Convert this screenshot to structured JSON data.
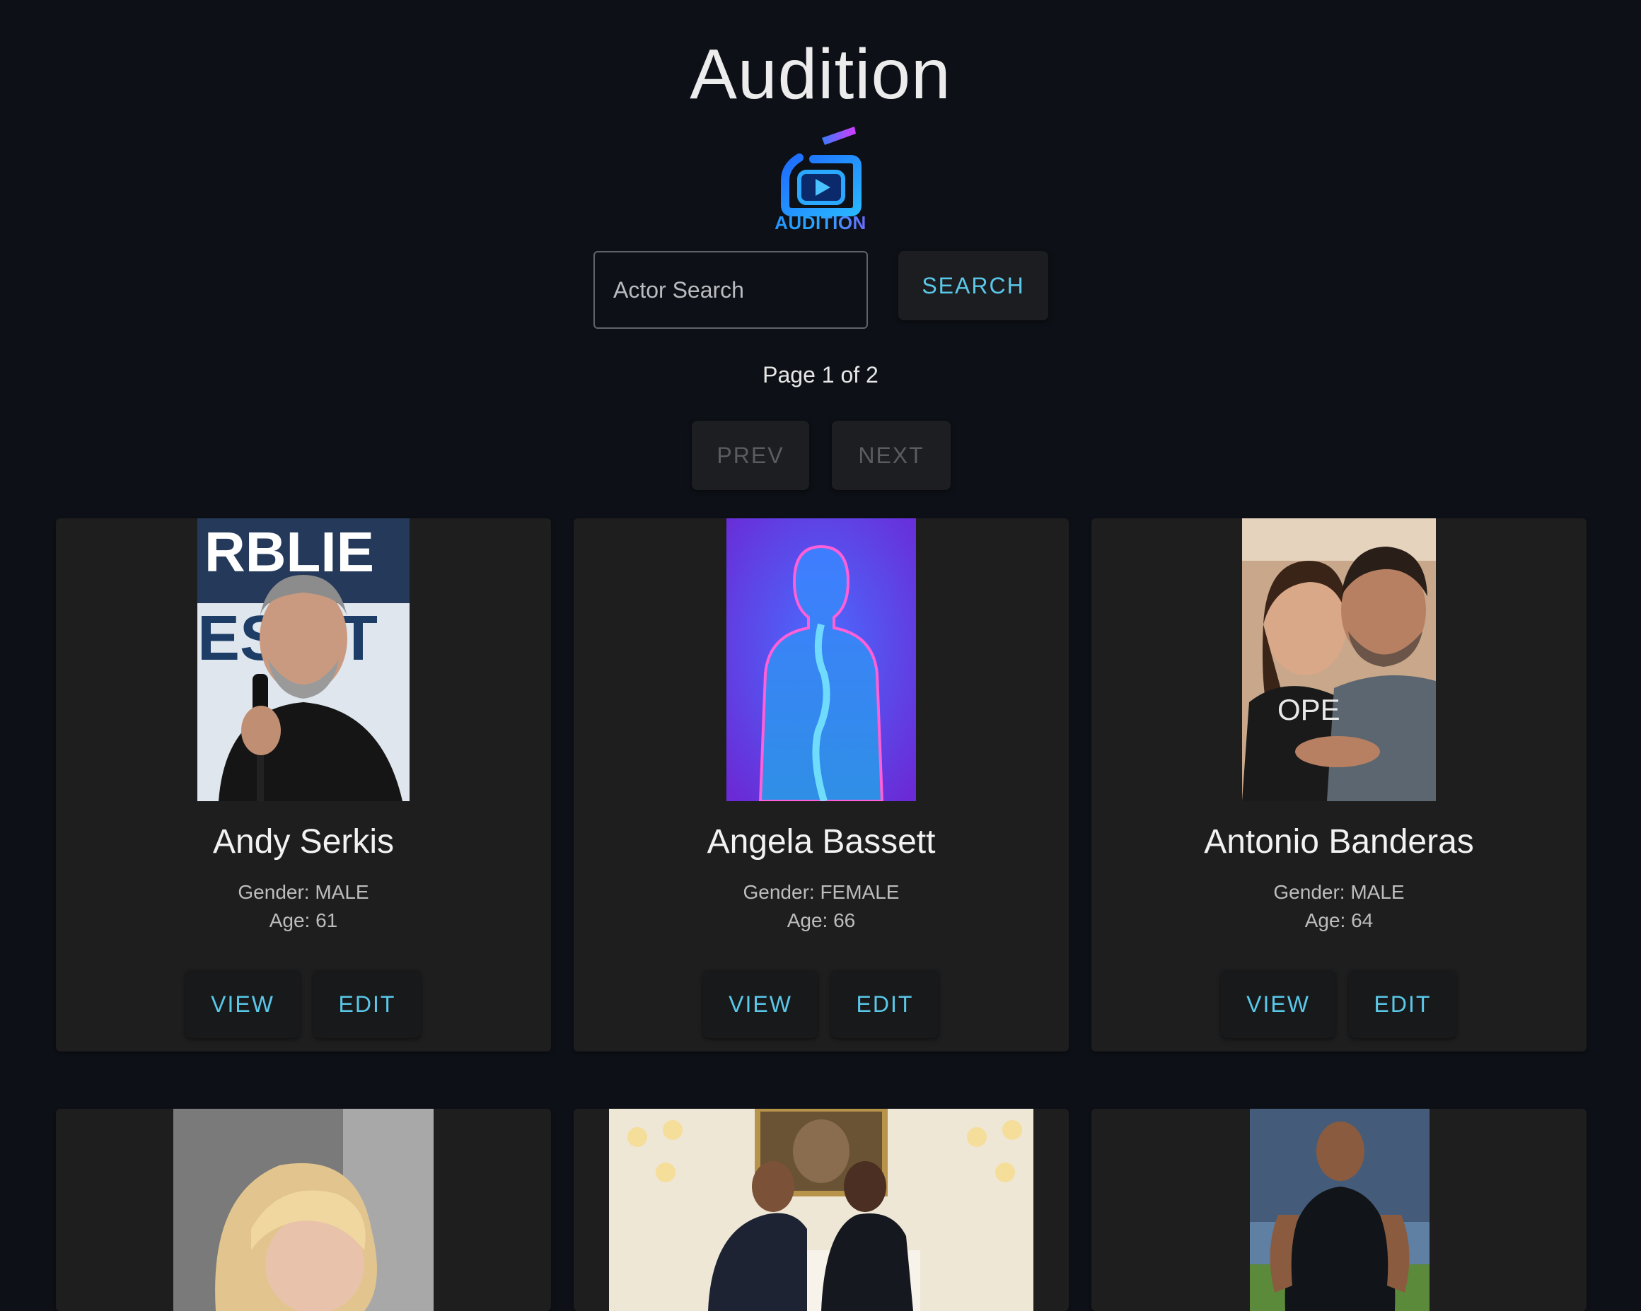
{
  "app": {
    "title": "Audition",
    "logo_text": "AUDITION"
  },
  "search": {
    "placeholder": "Actor Search",
    "button_label": "SEARCH"
  },
  "pagination": {
    "indicator": "Page 1 of 2",
    "prev_label": "PREV",
    "next_label": "NEXT"
  },
  "actors": [
    {
      "name": "Andy Serkis",
      "gender": "Gender: MALE",
      "age": "Age: 61",
      "view_label": "VIEW",
      "edit_label": "EDIT"
    },
    {
      "name": "Angela Bassett",
      "gender": "Gender: FEMALE",
      "age": "Age: 66",
      "view_label": "VIEW",
      "edit_label": "EDIT"
    },
    {
      "name": "Antonio Banderas",
      "gender": "Gender: MALE",
      "age": "Age: 64",
      "view_label": "VIEW",
      "edit_label": "EDIT"
    }
  ],
  "colors": {
    "background": "#0d1016",
    "card": "#1e1e1f",
    "accent": "#5ac8e8"
  }
}
